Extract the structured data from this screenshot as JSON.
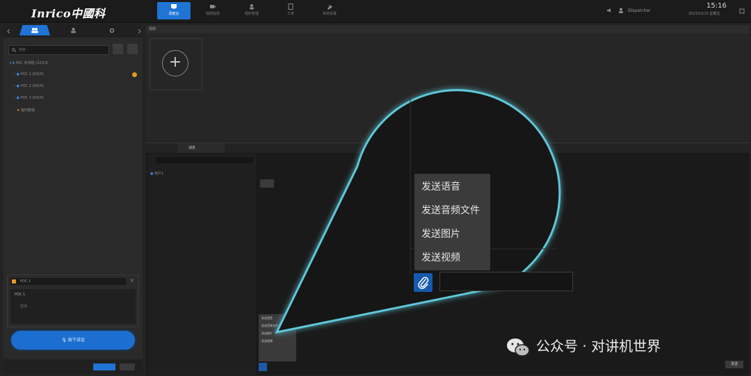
{
  "app": {
    "logo_text": "Inrico中國科",
    "nav_tabs": [
      {
        "icon": "map-pin-icon",
        "label": "调度台"
      },
      {
        "icon": "video-icon",
        "label": "视频监控"
      },
      {
        "icon": "people-icon",
        "label": "组织管理"
      },
      {
        "icon": "document-icon",
        "label": "工单"
      },
      {
        "icon": "wrench-icon",
        "label": "系统设置"
      }
    ],
    "clock": "15:16",
    "date": "2023/12/15 星期五",
    "user": "Dispatcher"
  },
  "left_panel": {
    "search_placeholder": "搜索",
    "tree": [
      {
        "label": "POC 内测组 (22/13)"
      },
      {
        "label": "POC 1 (0/0/0)"
      },
      {
        "label": "POC 2 (0/0/0)"
      },
      {
        "label": "POC 3 (0/0/0)"
      },
      {
        "label": "临时群组"
      }
    ],
    "talk_group": "POC 1",
    "talk_user": "POC 1",
    "talk_status": "空闲",
    "ptt_label": "按下讲话"
  },
  "main": {
    "header_label": "视频",
    "add_symbol": "+",
    "chat_tab_label": "消息",
    "contact_name": "用户1",
    "send_label": "发送"
  },
  "mini_menu": [
    "发送语音",
    "发送音频文件",
    "发送图片",
    "发送视频"
  ],
  "popup_menu": {
    "items": [
      "发送语音",
      "发送音频文件",
      "发送图片",
      "发送视频"
    ]
  },
  "watermark": "公众号 · 对讲机世界",
  "colors": {
    "accent": "#1f74d6",
    "callout_glow": "#5fc7d8"
  }
}
